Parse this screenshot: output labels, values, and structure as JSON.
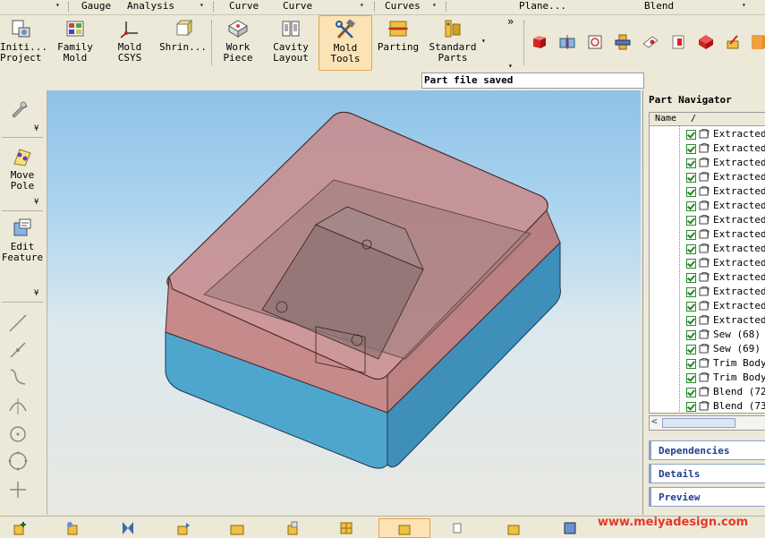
{
  "menu": {
    "items": [
      "Gauge",
      "Analysis",
      "Curve",
      "Curve",
      "Curves",
      "Plane...",
      "Blend"
    ]
  },
  "toolbar": {
    "buttons": [
      {
        "line1": "Initi...",
        "line2": "Project"
      },
      {
        "line1": "Family",
        "line2": "Mold"
      },
      {
        "line1": "Mold",
        "line2": "CSYS"
      },
      {
        "line1": "Shrin...",
        "line2": ""
      },
      {
        "line1": "Work",
        "line2": "Piece"
      },
      {
        "line1": "Cavity",
        "line2": "Layout"
      },
      {
        "line1": "Mold",
        "line2": "Tools"
      },
      {
        "line1": "Parting",
        "line2": ""
      },
      {
        "line1": "Standard",
        "line2": "Parts"
      }
    ],
    "overflow": "»"
  },
  "status": {
    "text": "Part file saved"
  },
  "left_palette": {
    "items": [
      {
        "line1": "Move",
        "line2": "Pole"
      },
      {
        "line1": "Edit",
        "line2": "Feature"
      }
    ]
  },
  "navigator": {
    "title": "Part Navigator",
    "column": "Name",
    "sort_glyph": "/",
    "rows": [
      "Extracted",
      "Extracted",
      "Extracted",
      "Extracted",
      "Extracted",
      "Extracted",
      "Extracted",
      "Extracted",
      "Extracted",
      "Extracted",
      "Extracted",
      "Extracted",
      "Extracted",
      "Extracted",
      "Sew (68)",
      "Sew (69)",
      "Trim Body",
      "Trim Body",
      "Blend (72)",
      "Blend (73)"
    ],
    "panels": [
      "Dependencies",
      "Details",
      "Preview"
    ]
  },
  "watermark": "www.meiyadesign.com",
  "colors": {
    "accent_active": "#fbe3b6",
    "box_top": "#c98a8a",
    "box_bottom": "#4fa6cc",
    "panel_text": "#1f3f8f"
  }
}
